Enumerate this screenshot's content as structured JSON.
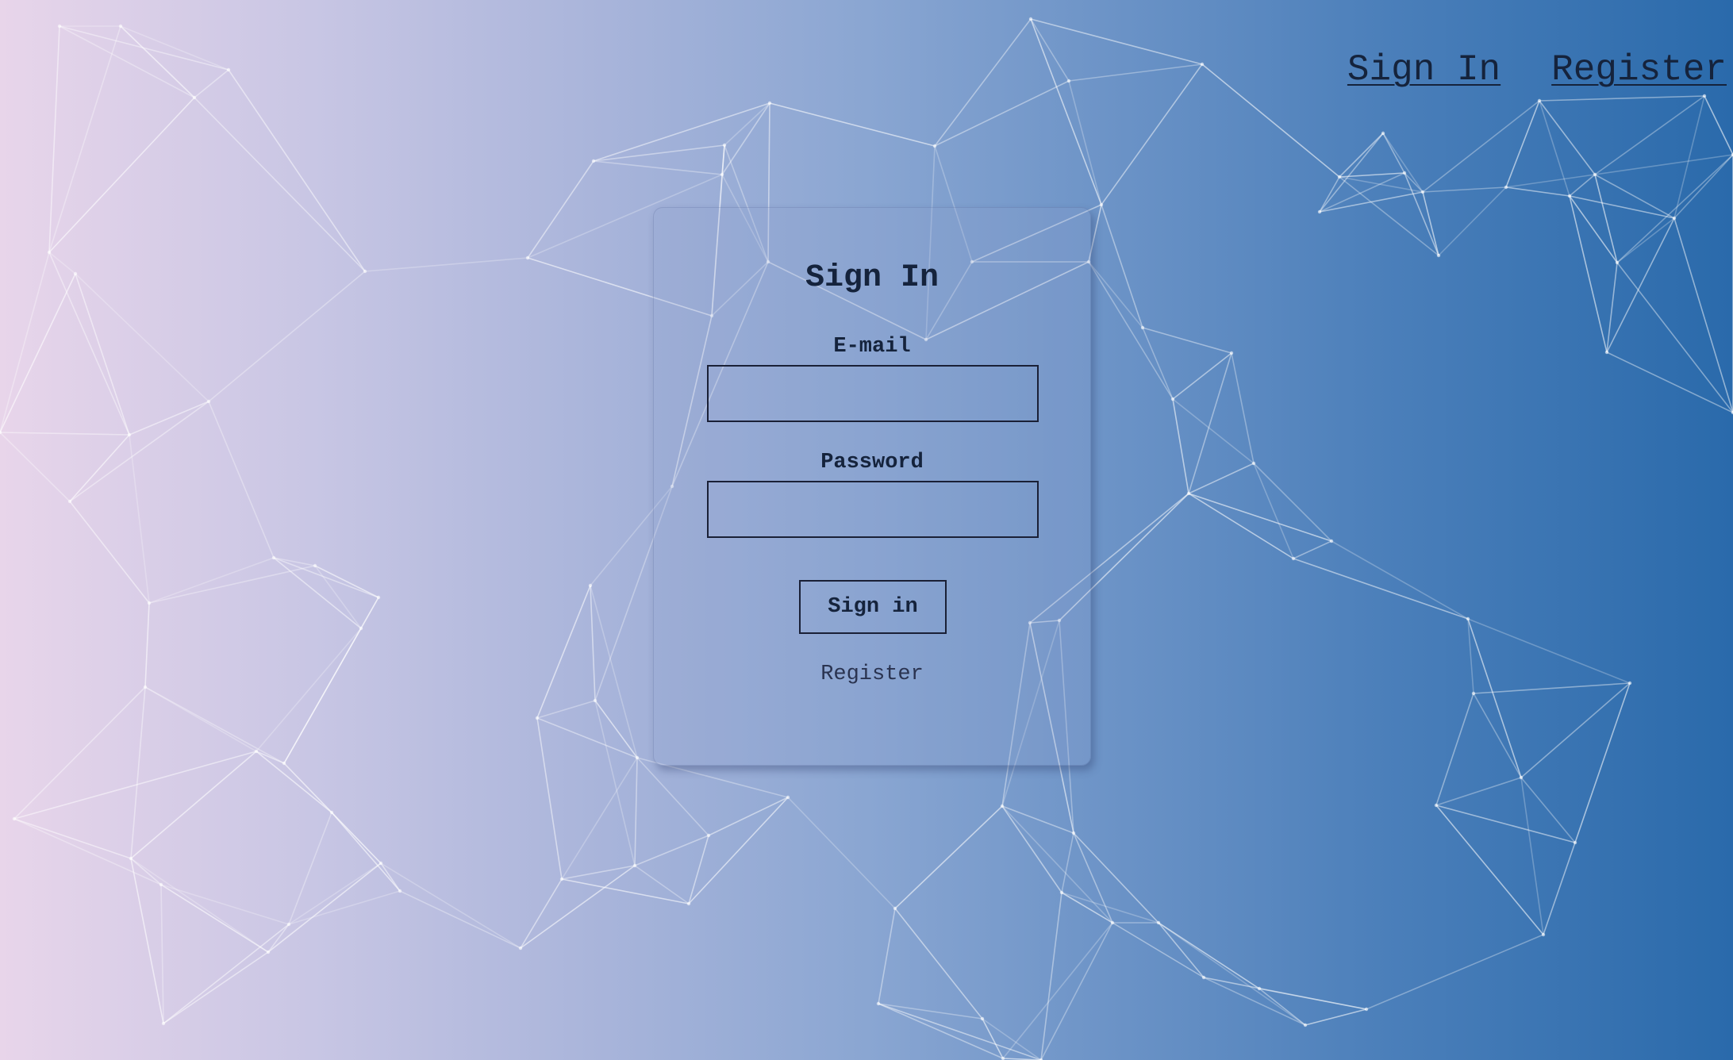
{
  "nav": {
    "sign_in": "Sign In",
    "register": "Register"
  },
  "form": {
    "title": "Sign In",
    "email_label": "E-mail",
    "email_value": "",
    "password_label": "Password",
    "password_value": "",
    "submit_label": "Sign in",
    "register_link": "Register"
  },
  "colors": {
    "gradient_start": "#e8d5ea",
    "gradient_end": "#2a6aab",
    "text": "#15233c",
    "network_lines": "#ffffff"
  }
}
